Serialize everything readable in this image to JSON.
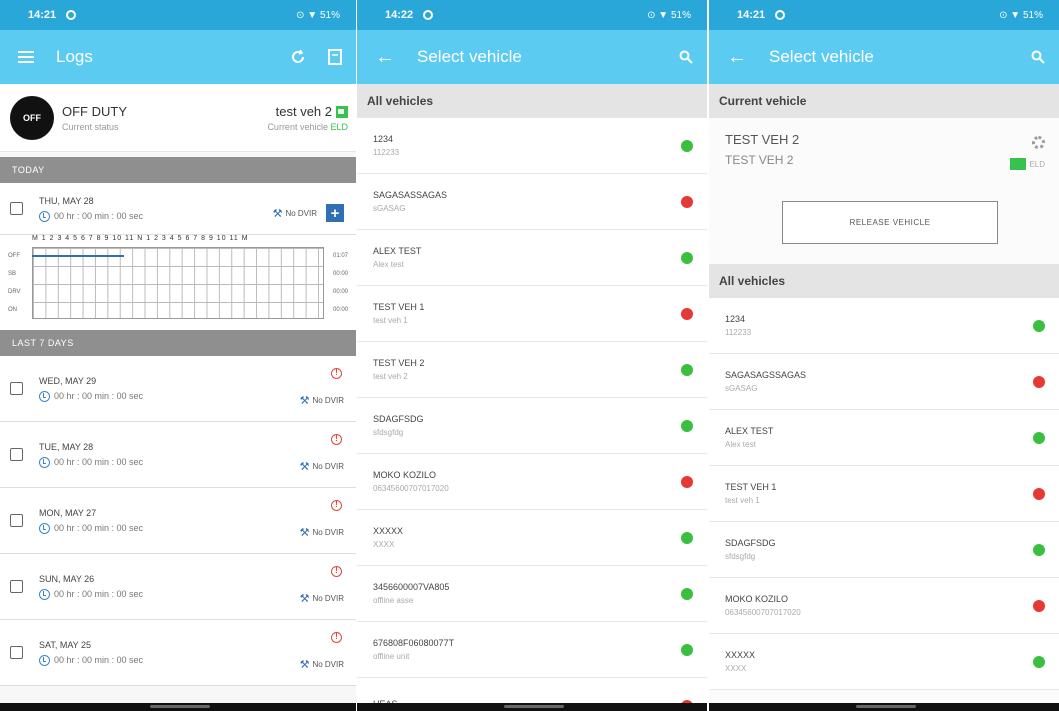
{
  "logs_screen": {
    "status_time": "14:21",
    "status_right": "⊙ ▼ 51%",
    "title": "Logs",
    "duty_badge": "OFF",
    "duty_status": "OFF DUTY",
    "duty_caption": "Current status",
    "vehicle": "test veh 2",
    "vehicle_caption": "Current vehicle",
    "vehicle_code": "ELD",
    "today_header": "TODAY",
    "today": {
      "date": "THU, MAY 28",
      "hours": "00 hr : 00 min : 00 sec",
      "dvir": "No DVIR",
      "add": "+"
    },
    "graph": {
      "hour_labels": "M 1 2 3 4 5 6 7 8 9 10 11 N 1 2 3 4 5 6 7 8 9 10 11 M",
      "row_labels": [
        "OFF",
        "SB",
        "DRV",
        "ON"
      ],
      "row_totals": [
        "01:07",
        "00:00",
        "00:00",
        "00:00"
      ]
    },
    "week_header": "LAST 7 DAYS",
    "days": [
      {
        "date": "WED, MAY 29",
        "hours": "00 hr : 00 min : 00 sec",
        "dvir": "No DVIR"
      },
      {
        "date": "TUE, MAY 28",
        "hours": "00 hr : 00 min : 00 sec",
        "dvir": "No DVIR"
      },
      {
        "date": "MON, MAY 27",
        "hours": "00 hr : 00 min : 00 sec",
        "dvir": "No DVIR"
      },
      {
        "date": "SUN, MAY 26",
        "hours": "00 hr : 00 min : 00 sec",
        "dvir": "No DVIR"
      },
      {
        "date": "SAT, MAY 25",
        "hours": "00 hr : 00 min : 00 sec",
        "dvir": "No DVIR"
      }
    ]
  },
  "select_screen": {
    "status_time": "14:22",
    "status_right": "⊙ ▼ 51%",
    "title": "Select vehicle",
    "list_header": "All vehicles",
    "vehicles": [
      {
        "name": "1234",
        "sub": "112233",
        "status": "green"
      },
      {
        "name": "SAGASASSAGAS",
        "sub": "sGASAG",
        "status": "red"
      },
      {
        "name": "ALEX TEST",
        "sub": "Alex test",
        "status": "green"
      },
      {
        "name": "TEST VEH 1",
        "sub": "test veh 1",
        "status": "red"
      },
      {
        "name": "TEST VEH 2",
        "sub": "test veh 2",
        "status": "green"
      },
      {
        "name": "SDAGFSDG",
        "sub": "sfdsgfdg",
        "status": "green"
      },
      {
        "name": "MOKO KOZILO",
        "sub": "06345600707017020",
        "status": "red"
      },
      {
        "name": "XXXXX",
        "sub": "XXXX",
        "status": "green"
      },
      {
        "name": "3456600007VA805",
        "sub": "offline asse",
        "status": "green"
      },
      {
        "name": "676808F06080077T",
        "sub": "offline unit",
        "status": "green"
      },
      {
        "name": "HEAS",
        "sub": "",
        "status": "red"
      }
    ]
  },
  "current_screen": {
    "status_time": "14:21",
    "status_right": "⊙ ▼ 51%",
    "title": "Select vehicle",
    "current_header": "Current vehicle",
    "current_name": "TEST VEH 2",
    "current_sub": "TEST VEH 2",
    "current_code": "ELD",
    "release_label": "RELEASE VEHICLE",
    "list_header": "All vehicles",
    "vehicles": [
      {
        "name": "1234",
        "sub": "112233",
        "status": "green"
      },
      {
        "name": "SAGASAGSSAGAS",
        "sub": "sGASAG",
        "status": "red"
      },
      {
        "name": "ALEX TEST",
        "sub": "Alex test",
        "status": "green"
      },
      {
        "name": "TEST VEH 1",
        "sub": "test veh 1",
        "status": "red"
      },
      {
        "name": "SDAGFSDG",
        "sub": "sfdsgfdg",
        "status": "green"
      },
      {
        "name": "MOKO KOZILO",
        "sub": "06345600707017020",
        "status": "red"
      },
      {
        "name": "XXXXX",
        "sub": "XXXX",
        "status": "green"
      }
    ]
  },
  "colors": {
    "statusbar": "#2aa7d9",
    "appbar": "#5ccbf1",
    "green": "#3bbf3f",
    "red": "#e53935",
    "accent": "#2f6fb3"
  }
}
